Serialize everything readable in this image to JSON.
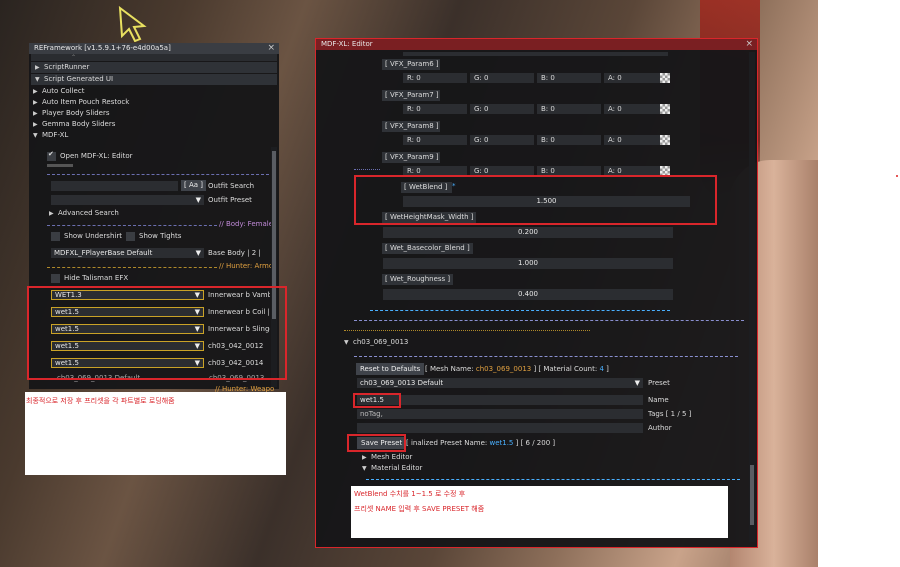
{
  "refw": {
    "title": "REFramework [v1.5.9.1+76-e4d00a5a]",
    "tree": [
      "ScriptRunner",
      "Script Generated UI"
    ],
    "items": [
      "Auto Collect",
      "Auto Item Pouch Restock",
      "Player Body Sliders",
      "Gemma Body Sliders",
      "MDF-XL"
    ],
    "open_editor": "Open MDF-XL: Editor",
    "search_btn": "[ Aa ]",
    "outfit_search": "Outfit Search",
    "outfit_preset": "Outfit Preset",
    "advanced_search": "Advanced Search",
    "body_sep": "// Body: Female",
    "show_undershirt": "Show Undershirt",
    "show_tights": "Show Tights",
    "base_combo": "MDFXL_FPlayerBase Default",
    "base_label": "Base Body | 2 |",
    "hunter_sep": "// Hunter: Armor",
    "hide_talisman": "Hide Talisman EFX",
    "presets": [
      {
        "value": "WET1.3",
        "label": "Innerwear b Vambr"
      },
      {
        "value": "wet1.5",
        "label": "Innerwear b Coil | 2"
      },
      {
        "value": "wet1.5",
        "label": "Innerwear b Slinger"
      },
      {
        "value": "wet1.5",
        "label": "ch03_042_0012"
      },
      {
        "value": "wet1.5",
        "label": "ch03_042_0014"
      }
    ],
    "cut_row_left": "ch03_069_0013 Default",
    "cut_row_right": "ch03_069_0013",
    "cut_sep": "// Hunter: Weapo",
    "note": "최종적으로 저장 후 프리셋을 각 파트별로 로딩해줌"
  },
  "editor": {
    "title": "MDF-XL: Editor",
    "vfx": [
      {
        "name": "[ VFX_Param6 ]",
        "r": "R: 0",
        "g": "G: 0",
        "b": "B: 0",
        "a": "A: 0"
      },
      {
        "name": "[ VFX_Param7 ]",
        "r": "R: 0",
        "g": "G: 0",
        "b": "B: 0",
        "a": "A: 0"
      },
      {
        "name": "[ VFX_Param8 ]",
        "r": "R: 0",
        "g": "G: 0",
        "b": "B: 0",
        "a": "A: 0"
      },
      {
        "name": "[ VFX_Param9 ]",
        "r": "R: 0",
        "g": "G: 0",
        "b": "B: 0",
        "a": "A: 0"
      }
    ],
    "wetblend_name": "[ WetBlend ]",
    "wetblend_star": "*",
    "wetblend_value": "1.500",
    "params": [
      {
        "name": "[ WetHeightMask_Width ]",
        "value": "0.200"
      },
      {
        "name": "[ Wet_Basecolor_Blend ]",
        "value": "1.000"
      },
      {
        "name": "[ Wet_Roughness ]",
        "value": "0.400"
      }
    ],
    "section": "ch03_069_0013",
    "reset_btn": "Reset to Defaults",
    "mesh_name_prefix": "[ Mesh Name:",
    "mesh_name": "ch03_069_0013",
    "mesh_name_suffix": "] [ Material Count:",
    "material_count": "4",
    "material_count_suffix": "]",
    "preset_combo": "ch03_069_0013 Default",
    "preset_label": "Preset",
    "name_value": "wet1.5",
    "name_label": "Name",
    "tags_value": "noTag,",
    "tags_label": "Tags [ 1 / 5 ]",
    "author_label": "Author",
    "save_btn": "Save Preset",
    "finalized_prefix": "[ inalized Preset Name:",
    "finalized_value": "wet1.5",
    "finalized_suffix": "] [ 6 / 200 ]",
    "mesh_editor": "Mesh Editor",
    "material_editor": "Material Editor",
    "note_line1": "WetBlend 수치를 1~1.5 로 수정 후",
    "note_line2": "프리셋 NAME 입력 후 SAVE PRESET 해줌"
  }
}
